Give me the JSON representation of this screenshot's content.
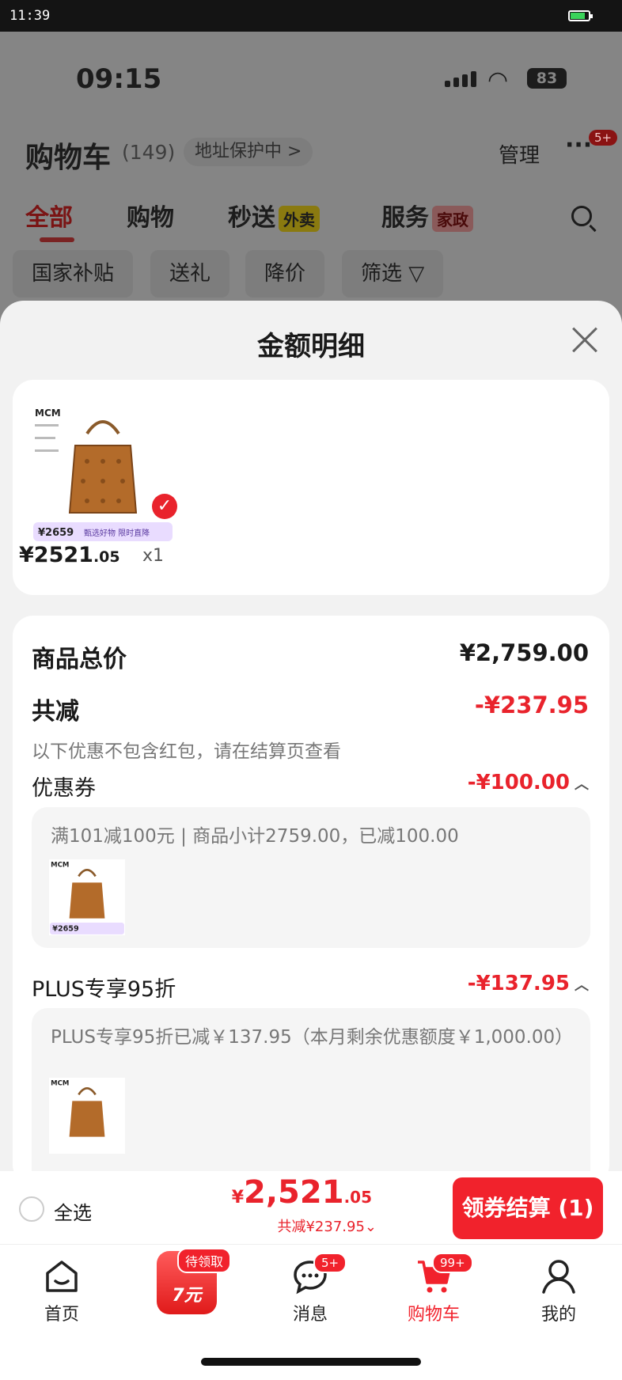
{
  "system_bar": {
    "time": "11:39"
  },
  "background": {
    "phone_time": "09:15",
    "battery": "83",
    "cart_title": "购物车",
    "cart_count": "(149)",
    "address": "地址保护中",
    "address_chevron": ">",
    "manage": "管理",
    "more": "···",
    "more_badge": "5+",
    "tabs": {
      "all": "全部",
      "shopping": "购物",
      "delivery": "秒送",
      "delivery_tag": "外卖",
      "service": "服务",
      "service_tag": "家政"
    },
    "chips": {
      "subsidy": "国家补贴",
      "gift": "送礼",
      "price_drop": "降价",
      "filter": "筛选 ▽"
    }
  },
  "sheet": {
    "title": "金额明细",
    "product": {
      "price_main": "¥2521",
      "price_cents": ".05",
      "quantity": "x1",
      "img_brand": "MCM",
      "img_tag_price": "¥2659",
      "img_tag_text": "甄选好物 限时直降"
    },
    "summary": {
      "total_label": "商品总价",
      "total_value": "¥2,759.00",
      "discount_label": "共减",
      "discount_value": "-¥237.95",
      "note": "以下优惠不包含红包，请在结算页查看"
    },
    "coupon": {
      "label": "优惠券",
      "value": "-¥100.00",
      "detail": "满101减100元 | 商品小计2759.00，已减100.00"
    },
    "plus": {
      "label": "PLUS专享95折",
      "value": "-¥137.95",
      "detail": "PLUS专享95折已减￥137.95（本月剩余优惠额度￥1,000.00）"
    }
  },
  "checkout": {
    "select_all": "全选",
    "yen": "¥",
    "total_main": "2,521",
    "total_cents": ".05",
    "saved": "共减¥237.95",
    "saved_caret": "⌄",
    "pay_button": "领券结算 (1)"
  },
  "tabbar": {
    "home": "首页",
    "promo_badge": "待领取",
    "promo_text": "7元",
    "messages": "消息",
    "messages_badge": "5+",
    "cart": "购物车",
    "cart_badge": "99+",
    "me": "我的"
  },
  "colors": {
    "accent": "#f1222c",
    "price_red": "#e9232c"
  }
}
